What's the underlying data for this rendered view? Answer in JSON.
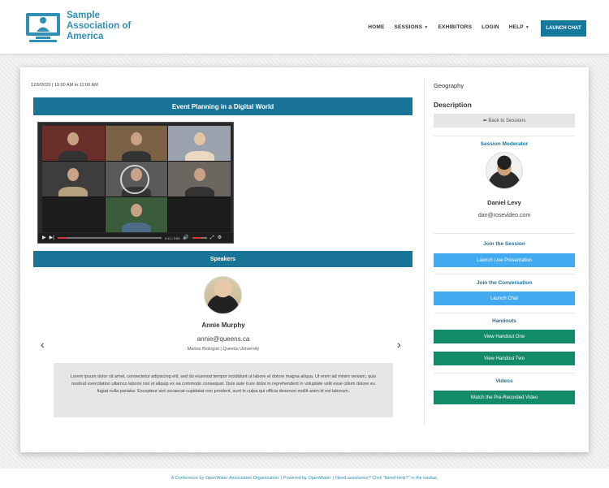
{
  "header": {
    "org_name": "Sample Association of America",
    "nav": [
      {
        "label": "HOME",
        "has_caret": false
      },
      {
        "label": "SESSIONS",
        "has_caret": true
      },
      {
        "label": "EXHIBITORS",
        "has_caret": false
      },
      {
        "label": "LOGIN",
        "has_caret": false
      },
      {
        "label": "HELP",
        "has_caret": true
      }
    ],
    "launch_chat": "LAUNCH CHAT"
  },
  "session": {
    "datetime": "12/9/2020 | 10:00 AM to 11:00 AM",
    "title": "Event Planning in a Digital World",
    "video": {
      "time": "0:11 / 2:00",
      "progress": 0.09,
      "volume": 0.6,
      "icons": [
        "play-icon",
        "skip-icon",
        "volume-icon",
        "fullscreen-icon",
        "settings-icon"
      ]
    },
    "speakers_heading": "Speakers",
    "speaker": {
      "name": "Annie Murphy",
      "email": "annie@queens.ca",
      "role": "Marine Biologist | Queens University",
      "bio": "Lorem ipsum dolor sit amet, consectetur adipiscing elit, sed do eiusmod tempor incididunt ut labore et dolore magna aliqua. Ut enim ad minim veniam, quis nostrud exercitation ullamco laboris nisi ut aliquip ex ea commodo consequat. Duis aute irure dolor in reprehenderit in voluptate velit esse cillum dolore eu fugiat nulla pariatur. Excepteur sint occaecat cupidatat non proident, sunt in culpa qui officia deserunt mollit anim id est laborum."
    }
  },
  "sidebar": {
    "topic": "Geography",
    "description_heading": "Description",
    "back_label": "⬅ Back to Sessions",
    "moderator_heading": "Session Moderator",
    "moderator_name": "Daniel Levy",
    "moderator_email": "dan@rosevideo.com",
    "join_session_heading": "Join the Session",
    "launch_live_label": "Launch Live Presentation",
    "join_conversation_heading": "Join the Conversation",
    "launch_chat_label": "Launch Chat",
    "handouts_heading": "Handouts",
    "handouts": [
      "View Handout One",
      "View Handout Two"
    ],
    "videos_heading": "Videos",
    "video_button": "Watch the Pre-Recorded Video"
  },
  "footer": {
    "text": "A Conference by OpenWater Association Organization. | Powered by OpenWater. | Need assistance? Click \"Need Help?\" in the navbar."
  },
  "colors": {
    "brand": "#2f8fb5",
    "title_bar": "#1a7498",
    "action_blue": "#42aaf0",
    "action_green": "#138a68"
  }
}
